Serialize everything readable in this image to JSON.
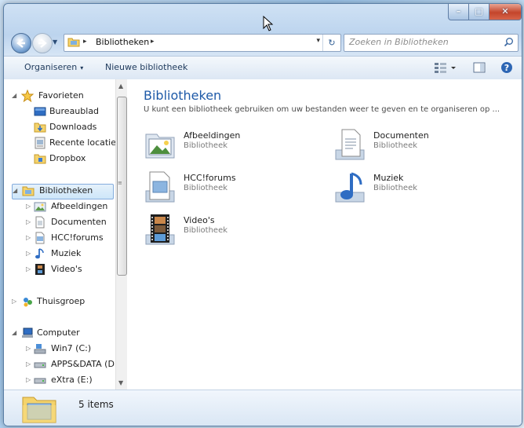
{
  "window": {
    "controls": {
      "minimize": "–",
      "maximize": "□",
      "close": "✕"
    }
  },
  "address": {
    "crumb": "Bibliotheken",
    "separator": "▸",
    "dropdown": "▾",
    "refresh": "↻"
  },
  "search": {
    "placeholder": "Zoeken in Bibliotheken"
  },
  "commandbar": {
    "organize": "Organiseren",
    "new_library": "Nieuwe bibliotheek",
    "organize_arrow": "▾"
  },
  "nav": {
    "favorites": "Favorieten",
    "favorites_items": [
      "Bureaublad",
      "Downloads",
      "Recente locaties",
      "Dropbox"
    ],
    "libraries": "Bibliotheken",
    "libraries_items": [
      "Afbeeldingen",
      "Documenten",
      "HCC!forums",
      "Muziek",
      "Video's"
    ],
    "homegroup": "Thuisgroep",
    "computer": "Computer",
    "computer_items": [
      "Win7 (C:)",
      "APPS&DATA (D:)",
      "eXtra (E:)"
    ]
  },
  "main": {
    "title": "Bibliotheken",
    "subtitle": "U kunt een bibliotheek gebruiken om uw bestanden weer te geven en te organiseren op ...",
    "tiles": [
      {
        "name": "Afbeeldingen",
        "type": "Bibliotheek",
        "icon": "pictures-library-icon"
      },
      {
        "name": "Documenten",
        "type": "Bibliotheek",
        "icon": "documents-library-icon"
      },
      {
        "name": "HCC!forums",
        "type": "Bibliotheek",
        "icon": "folder-library-icon"
      },
      {
        "name": "Muziek",
        "type": "Bibliotheek",
        "icon": "music-library-icon"
      },
      {
        "name": "Video's",
        "type": "Bibliotheek",
        "icon": "videos-library-icon"
      }
    ]
  },
  "details": {
    "count": "5 items"
  },
  "colors": {
    "title_blue": "#1e5aa8",
    "selection": "#cde6f9"
  }
}
